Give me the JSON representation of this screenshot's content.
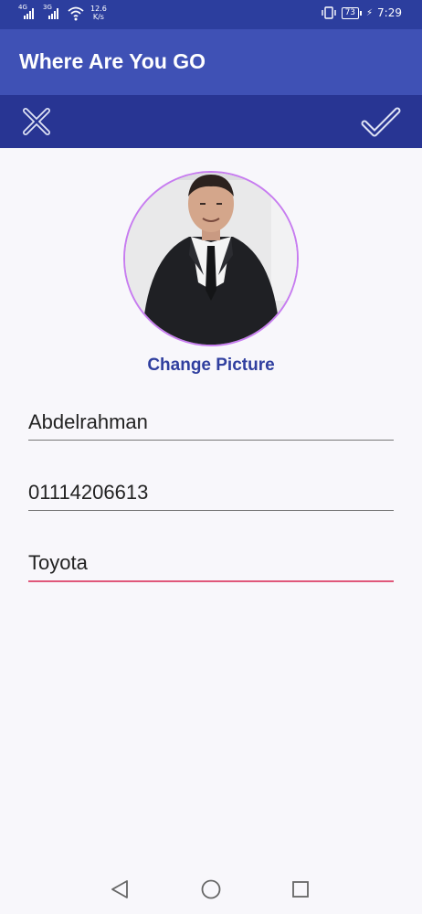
{
  "status_bar": {
    "signal1_tag": "4G",
    "signal2_tag": "3G",
    "speed_value": "12.6",
    "speed_unit": "K/s",
    "battery": "73",
    "time": "7:29"
  },
  "app_bar": {
    "title": "Where Are You GO"
  },
  "action_bar": {
    "close_icon": "close-icon",
    "confirm_icon": "check-icon"
  },
  "profile": {
    "change_picture_label": "Change Picture"
  },
  "form": {
    "name": "Abdelrahman",
    "phone": "01114206613",
    "car": "Toyota"
  },
  "nav": {
    "back_icon": "back-icon",
    "home_icon": "home-icon",
    "recent_icon": "recent-apps-icon"
  },
  "colors": {
    "status_bar": "#2c3e9e",
    "app_bar": "#3f51b5",
    "action_bar": "#283593",
    "accent": "#303f9f",
    "focus_underline": "#e0577a",
    "avatar_border": "#c77cf0"
  }
}
